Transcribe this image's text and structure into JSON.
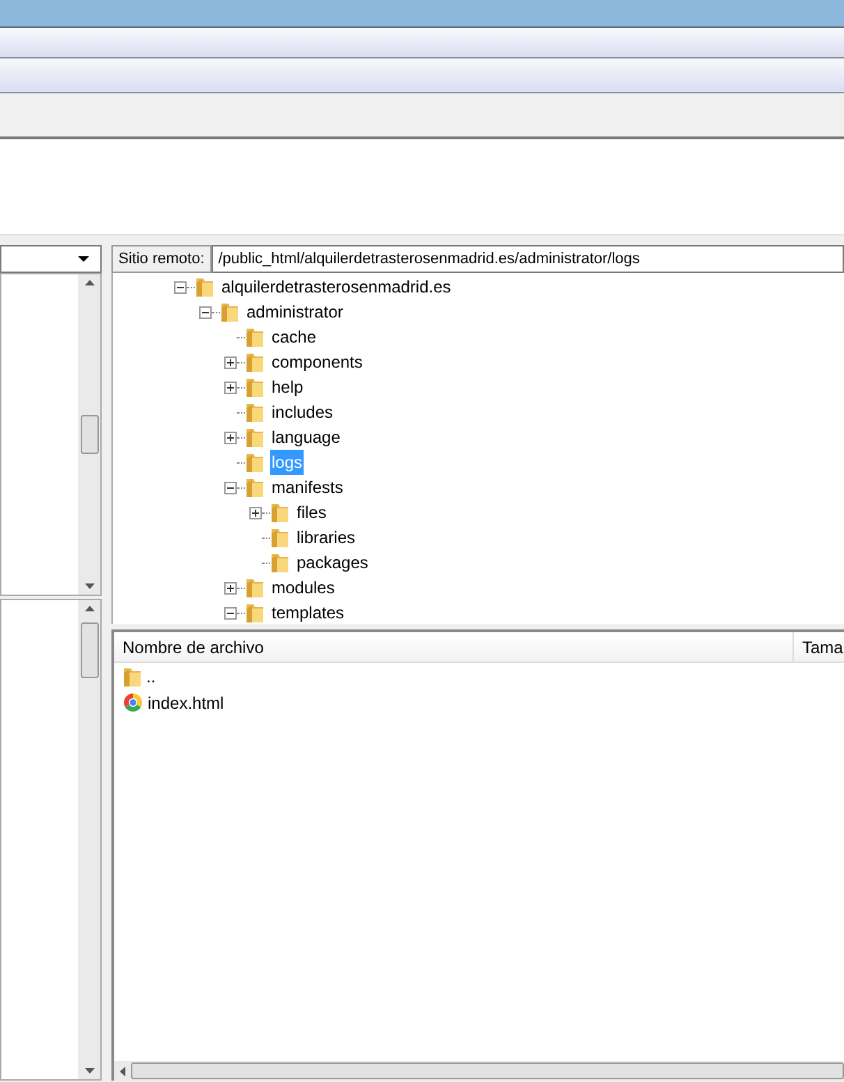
{
  "remote_site": {
    "label": "Sitio remoto:",
    "path": "/public_html/alquilerdetrasterosenmadrid.es/administrator/logs"
  },
  "tree": [
    {
      "label": "alquilerdetrasterosenmadrid.es",
      "expanded": true,
      "selected": false,
      "children": [
        {
          "label": "administrator",
          "expanded": true,
          "selected": false,
          "children": [
            {
              "label": "cache",
              "selected": false
            },
            {
              "label": "components",
              "expanded": false,
              "selected": false
            },
            {
              "label": "help",
              "expanded": false,
              "selected": false
            },
            {
              "label": "includes",
              "selected": false
            },
            {
              "label": "language",
              "expanded": false,
              "selected": false
            },
            {
              "label": "logs",
              "selected": true
            },
            {
              "label": "manifests",
              "expanded": true,
              "selected": false,
              "children": [
                {
                  "label": "files",
                  "expanded": false,
                  "selected": false
                },
                {
                  "label": "libraries",
                  "selected": false
                },
                {
                  "label": "packages",
                  "selected": false
                }
              ]
            },
            {
              "label": "modules",
              "expanded": false,
              "selected": false
            },
            {
              "label": "templates",
              "expanded": true,
              "selected": false
            }
          ]
        }
      ]
    }
  ],
  "file_list": {
    "columns": [
      "Nombre de archivo",
      "Tama"
    ],
    "rows": [
      {
        "name": "..",
        "kind": "folder"
      },
      {
        "name": "index.html",
        "kind": "html"
      }
    ]
  }
}
